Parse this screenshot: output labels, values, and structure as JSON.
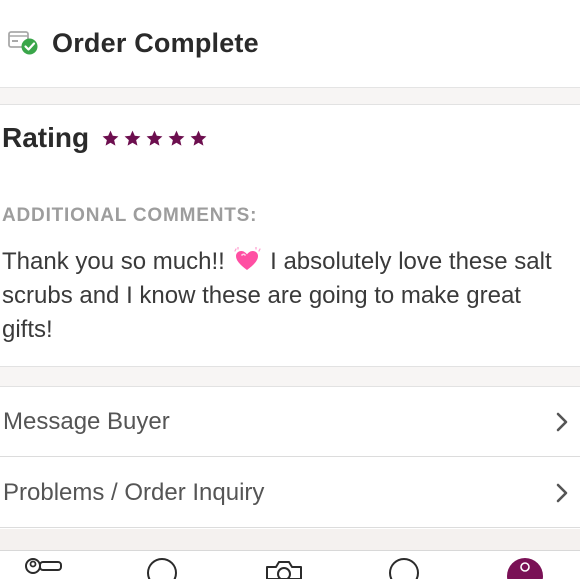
{
  "header": {
    "title": "Order Complete",
    "status_icon": "package-check-icon"
  },
  "rating": {
    "label": "Rating",
    "stars": 5,
    "max_stars": 5,
    "star_color": "#6d0f4f"
  },
  "comments": {
    "label": "ADDITIONAL COMMENTS:",
    "text_before_emoji": "Thank you so much!!",
    "emoji": "sparkling-heart",
    "text_after_emoji": "I absolutely love these salt scrubs and I know these are going to make great gifts!"
  },
  "actions": [
    {
      "label": "Message Buyer",
      "icon": "chevron-right-icon"
    },
    {
      "label": "Problems / Order Inquiry",
      "icon": "chevron-right-icon"
    }
  ],
  "tabbar": {
    "items": [
      {
        "icon": "people-tag-icon"
      },
      {
        "icon": "search-icon"
      },
      {
        "icon": "camera-icon"
      },
      {
        "icon": "chat-icon"
      },
      {
        "icon": "profile-icon"
      }
    ],
    "accent": "#7a1156"
  },
  "colors": {
    "check_green": "#3aa64a",
    "comment_label_gray": "#9d9d9d",
    "strip_bg": "#f7f5f4"
  }
}
